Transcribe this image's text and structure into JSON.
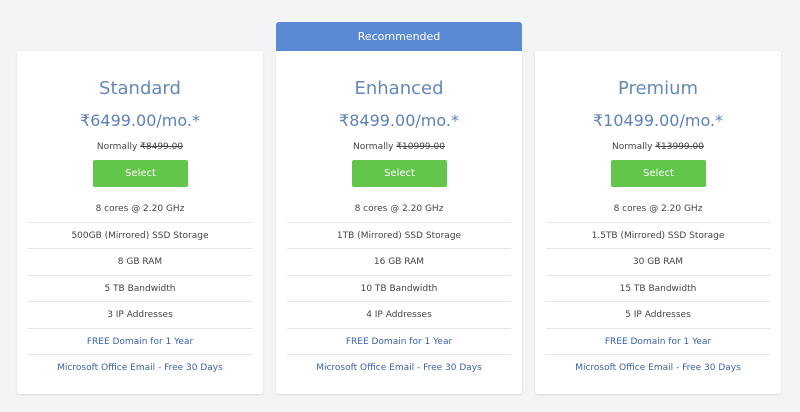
{
  "recommended_label": "Recommended",
  "plans": [
    {
      "name": "Standard",
      "price": "₹6499.00/mo.*",
      "normally_label": "Normally",
      "old_price": "₹8499.00",
      "select_label": "Select",
      "features": [
        "8 cores @ 2.20 GHz",
        "500GB (Mirrored) SSD Storage",
        "8 GB RAM",
        "5 TB Bandwidth",
        "3 IP Addresses"
      ],
      "domain_link": "FREE Domain for 1 Year",
      "email_link": "Microsoft Office Email - Free 30 Days"
    },
    {
      "name": "Enhanced",
      "price": "₹8499.00/mo.*",
      "normally_label": "Normally",
      "old_price": "₹10999.00",
      "select_label": "Select",
      "features": [
        "8 cores @ 2.20 GHz",
        "1TB (Mirrored) SSD Storage",
        "16 GB RAM",
        "10 TB Bandwidth",
        "4 IP Addresses"
      ],
      "domain_link": "FREE Domain for 1 Year",
      "email_link": "Microsoft Office Email - Free 30 Days"
    },
    {
      "name": "Premium",
      "price": "₹10499.00/mo.*",
      "normally_label": "Normally",
      "old_price": "₹13999.00",
      "select_label": "Select",
      "features": [
        "8 cores @ 2.20 GHz",
        "1.5TB (Mirrored) SSD Storage",
        "30 GB RAM",
        "15 TB Bandwidth",
        "5 IP Addresses"
      ],
      "domain_link": "FREE Domain for 1 Year",
      "email_link": "Microsoft Office Email - Free 30 Days"
    }
  ],
  "colors": {
    "accent_blue": "#5b8ad5",
    "select_green": "#62c64a",
    "link_blue": "#3a62a8"
  }
}
